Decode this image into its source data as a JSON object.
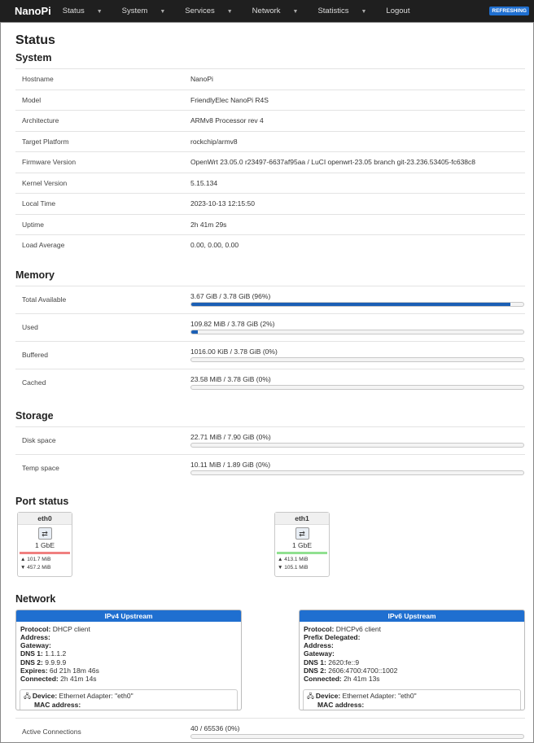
{
  "nav": {
    "brand": "NanoPi",
    "menu": [
      {
        "label": "Status",
        "caret": true
      },
      {
        "label": "System",
        "caret": true
      },
      {
        "label": "Services",
        "caret": true
      },
      {
        "label": "Network",
        "caret": true
      },
      {
        "label": "Statistics",
        "caret": true
      },
      {
        "label": "Logout",
        "caret": false
      }
    ],
    "refresh_badge": "REFRESHING"
  },
  "page": {
    "title": "Status"
  },
  "system": {
    "heading": "System",
    "rows": [
      {
        "key": "Hostname",
        "value": "NanoPi"
      },
      {
        "key": "Model",
        "value": "FriendlyElec NanoPi R4S"
      },
      {
        "key": "Architecture",
        "value": "ARMv8 Processor rev 4"
      },
      {
        "key": "Target Platform",
        "value": "rockchip/armv8"
      },
      {
        "key": "Firmware Version",
        "value": "OpenWrt 23.05.0 r23497-6637af95aa / LuCI openwrt-23.05 branch git-23.236.53405-fc638c8"
      },
      {
        "key": "Kernel Version",
        "value": "5.15.134"
      },
      {
        "key": "Local Time",
        "value": "2023-10-13 12:15:50"
      },
      {
        "key": "Uptime",
        "value": "2h 41m 29s"
      },
      {
        "key": "Load Average",
        "value": "0.00, 0.00, 0.00"
      }
    ]
  },
  "memory": {
    "heading": "Memory",
    "rows": [
      {
        "key": "Total Available",
        "text": "3.67 GiB / 3.78 GiB (96%)",
        "percent": 96
      },
      {
        "key": "Used",
        "text": "109.82 MiB / 3.78 GiB (2%)",
        "percent": 2
      },
      {
        "key": "Buffered",
        "text": "1016.00 KiB / 3.78 GiB (0%)",
        "percent": 0
      },
      {
        "key": "Cached",
        "text": "23.58 MiB / 3.78 GiB (0%)",
        "percent": 0
      }
    ]
  },
  "storage": {
    "heading": "Storage",
    "rows": [
      {
        "key": "Disk space",
        "text": "22.71 MiB / 7.90 GiB (0%)",
        "percent": 0
      },
      {
        "key": "Temp space",
        "text": "10.11 MiB / 1.89 GiB (0%)",
        "percent": 0
      }
    ]
  },
  "ports": {
    "heading": "Port status",
    "items": [
      {
        "name": "eth0",
        "speed": "1 GbE",
        "tx": "▲ 101.7 MiB",
        "rx": "▼ 457.2 MiB",
        "link_color": "#f08080"
      },
      {
        "name": "eth1",
        "speed": "1 GbE",
        "tx": "▲ 413.1 MiB",
        "rx": "▼ 105.1 MiB",
        "link_color": "#90e090"
      }
    ]
  },
  "network": {
    "heading": "Network",
    "ipv4": {
      "title": "IPv4 Upstream",
      "protocol_label": "Protocol:",
      "protocol": "DHCP client",
      "address_label": "Address:",
      "gateway_label": "Gateway:",
      "dns1_label": "DNS 1:",
      "dns1": "1.1.1.2",
      "dns2_label": "DNS 2:",
      "dns2": "9.9.9.9",
      "expires_label": "Expires:",
      "expires": "6d 21h 18m 46s",
      "connected_label": "Connected:",
      "connected": "2h 41m 14s",
      "device_label": "Device:",
      "device": "Ethernet Adapter: \"eth0\"",
      "mac_label": "MAC address:"
    },
    "ipv6": {
      "title": "IPv6 Upstream",
      "protocol_label": "Protocol:",
      "protocol": "DHCPv6 client",
      "prefix_label": "Prefix Delegated:",
      "address_label": "Address:",
      "gateway_label": "Gateway:",
      "dns1_label": "DNS 1:",
      "dns1": "2620:fe::9",
      "dns2_label": "DNS 2:",
      "dns2": "2606:4700:4700::1002",
      "connected_label": "Connected:",
      "connected": "2h 41m 13s",
      "device_label": "Device:",
      "device": "Ethernet Adapter: \"eth0\"",
      "mac_label": "MAC address:"
    },
    "active": {
      "key": "Active Connections",
      "text": "40 / 65536 (0%)",
      "percent": 0
    }
  },
  "colors": {
    "accent": "#1f6fd0",
    "bar_fill": "#1b5fb5"
  }
}
